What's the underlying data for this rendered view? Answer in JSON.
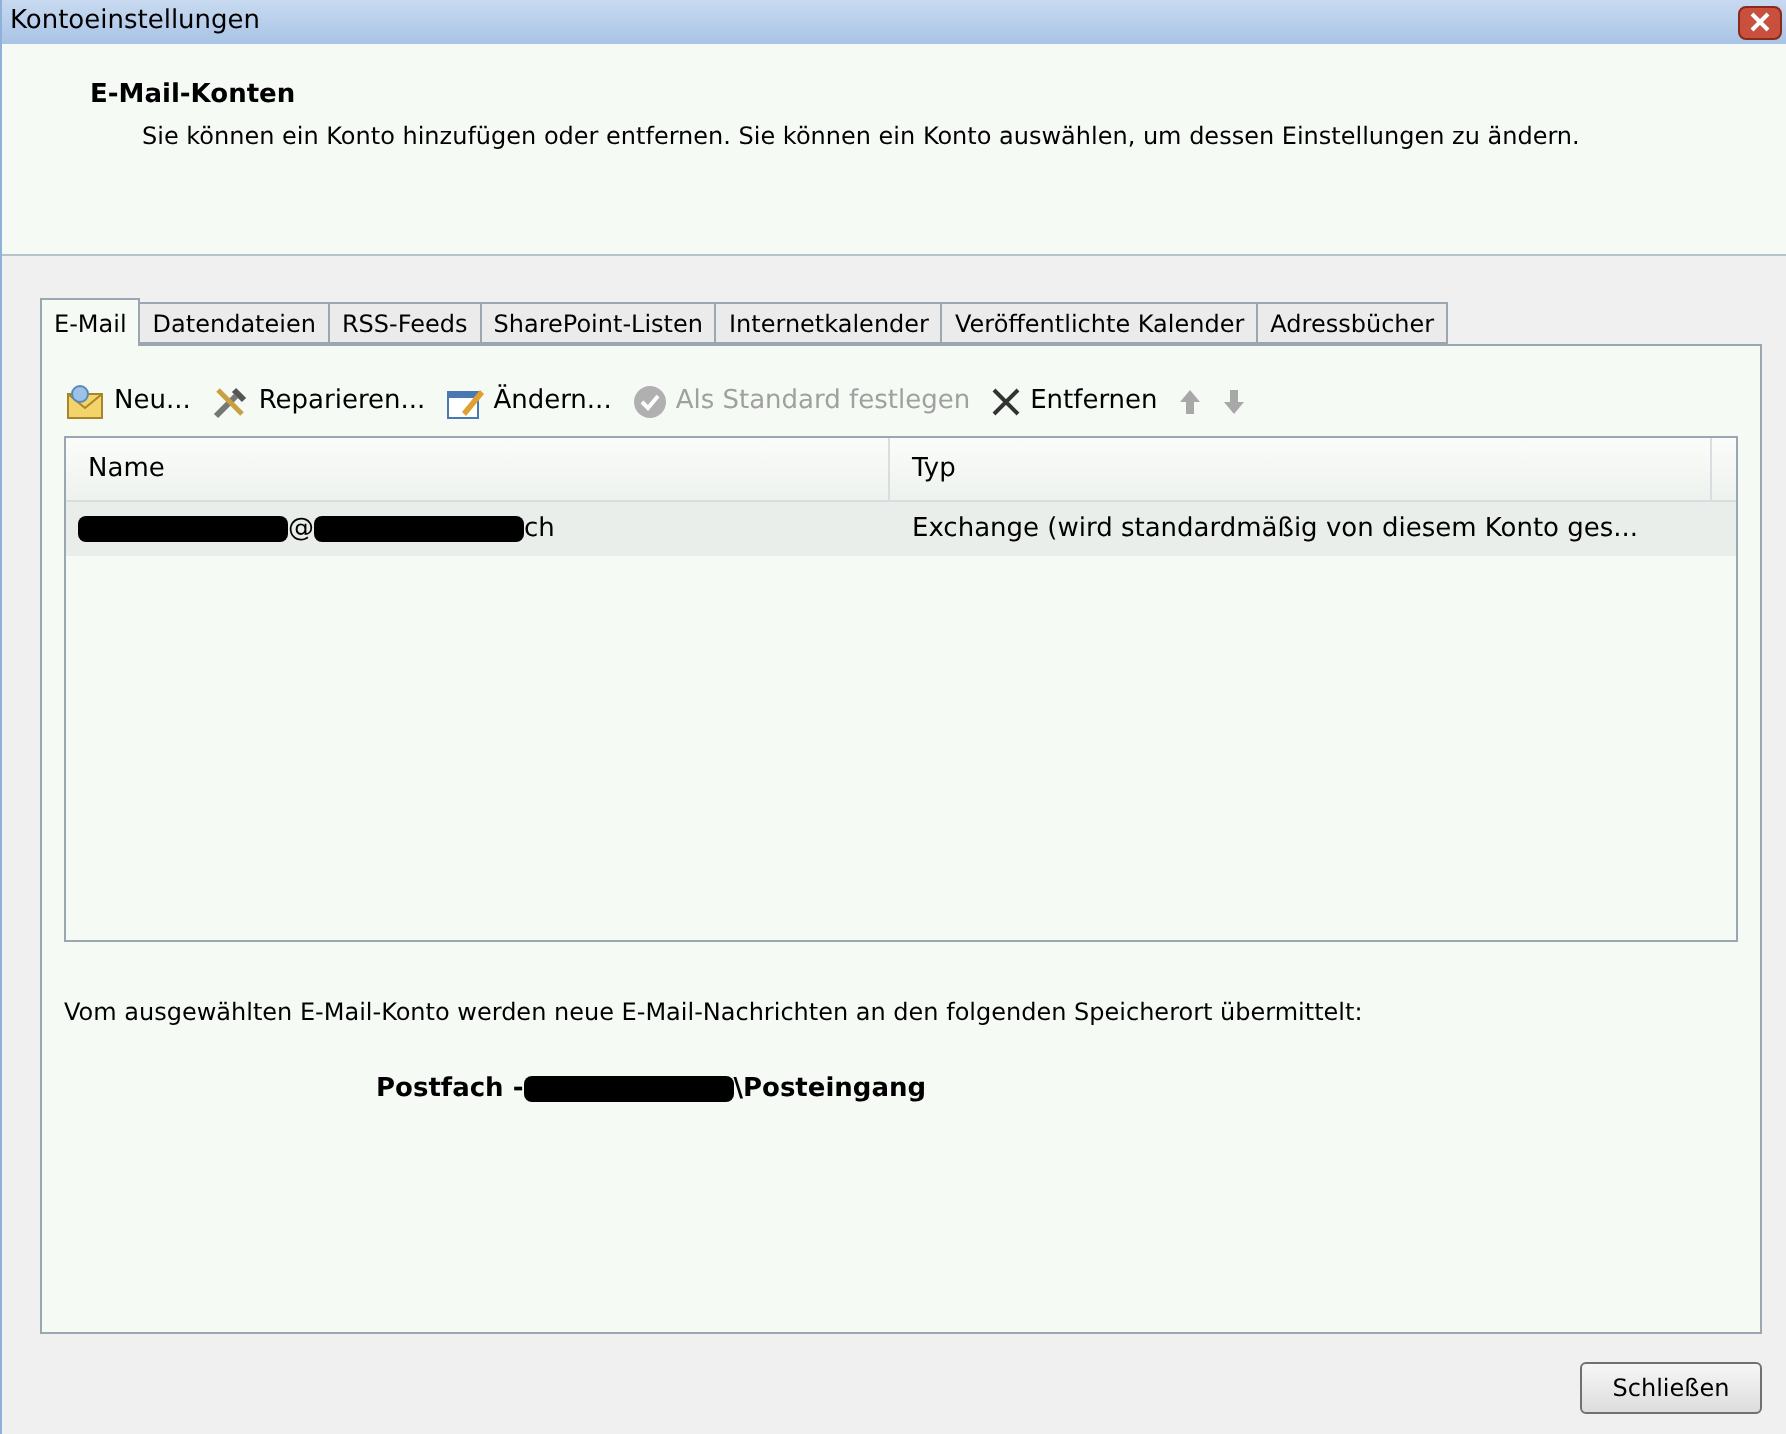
{
  "window": {
    "title": "Kontoeinstellungen"
  },
  "header": {
    "title": "E-Mail-Konten",
    "description": "Sie können ein Konto hinzufügen oder entfernen. Sie können ein Konto auswählen, um dessen Einstellungen zu ändern."
  },
  "tabs": [
    {
      "label": "E-Mail",
      "selected": true
    },
    {
      "label": "Datendateien",
      "selected": false
    },
    {
      "label": "RSS-Feeds",
      "selected": false
    },
    {
      "label": "SharePoint-Listen",
      "selected": false
    },
    {
      "label": "Internetkalender",
      "selected": false
    },
    {
      "label": "Veröffentlichte Kalender",
      "selected": false
    },
    {
      "label": "Adressbücher",
      "selected": false
    }
  ],
  "toolbar": [
    {
      "kind": "new",
      "label": "Neu...",
      "disabled": false
    },
    {
      "kind": "repair",
      "label": "Reparieren...",
      "disabled": false
    },
    {
      "kind": "change",
      "label": "Ändern...",
      "disabled": false
    },
    {
      "kind": "default",
      "label": "Als Standard festlegen",
      "disabled": true
    },
    {
      "kind": "remove",
      "label": "Entfernen",
      "disabled": false
    },
    {
      "kind": "up",
      "disabled": true
    },
    {
      "kind": "down",
      "disabled": true
    }
  ],
  "table": {
    "columns": [
      "Name",
      "Typ"
    ],
    "rows": [
      {
        "selected": false,
        "name_parts": [
          {
            "kind": "redacted"
          },
          {
            "kind": "text",
            "text": "@"
          },
          {
            "kind": "redacted"
          },
          {
            "kind": "text",
            "text": "ch"
          }
        ],
        "type": "Exchange (wird standardmäßig von diesem Konto ges..."
      }
    ]
  },
  "delivery": {
    "text": "Vom ausgewählten E-Mail-Konto werden neue E-Mail-Nachrichten an den folgenden Speicherort übermittelt:",
    "location_parts": [
      {
        "kind": "text",
        "text": "Postfach -"
      },
      {
        "kind": "redacted"
      },
      {
        "kind": "text",
        "text": "\\Posteingang"
      }
    ]
  },
  "buttons": [
    {
      "label": "Schließen"
    }
  ]
}
